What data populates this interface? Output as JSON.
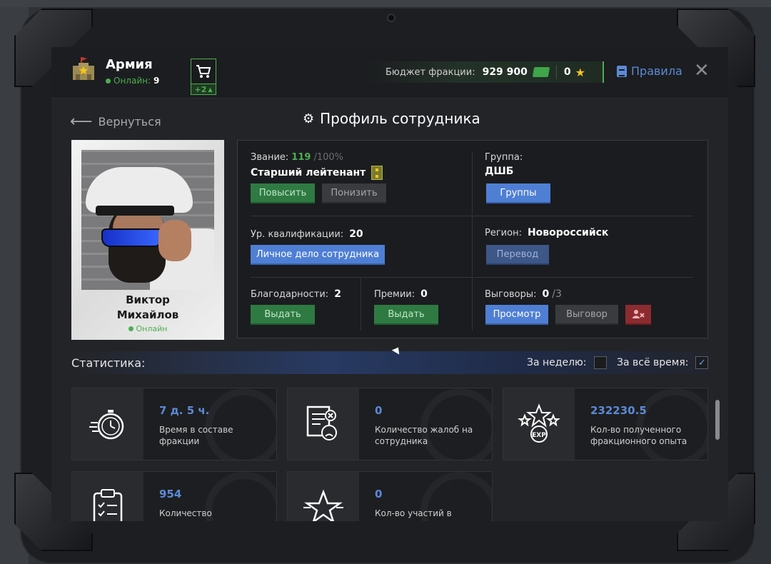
{
  "header": {
    "faction_name": "Армия",
    "online_label": "Онлайн:",
    "online_count": "9",
    "cart_badge": "+2",
    "budget_label": "Бюджет фракции:",
    "budget_value": "929 900",
    "stars_value": "0",
    "rules_label": "Правила"
  },
  "nav": {
    "back_label": "Вернуться",
    "page_title": "Профиль сотрудника"
  },
  "profile": {
    "name_line1": "Виктор",
    "name_line2": "Михайлов",
    "status": "Онлайн"
  },
  "info": {
    "rank_label": "Звание:",
    "rank_progress": "119",
    "rank_progress_max": "/100%",
    "rank_name": "Старший лейтенант",
    "promote_btn": "Повысить",
    "demote_btn": "Понизить",
    "group_label": "Группа:",
    "group_value": "ДШБ",
    "groups_btn": "Группы",
    "qual_label": "Ур. квалификации:",
    "qual_value": "20",
    "dossier_btn": "Личное дело сотрудника",
    "region_label": "Регион:",
    "region_value": "Новороссийск",
    "transfer_btn": "Перевод",
    "thanks_label": "Благодарности:",
    "thanks_value": "2",
    "thanks_btn": "Выдать",
    "bonus_label": "Премии:",
    "bonus_value": "0",
    "bonus_btn": "Выдать",
    "reprimand_label": "Выговоры:",
    "reprimand_value": "0",
    "reprimand_max": "/3",
    "view_btn": "Просмотр",
    "reprimand_btn": "Выговор"
  },
  "stats": {
    "title": "Статистика:",
    "week_label": "За неделю:",
    "alltime_label": "За всё время:",
    "week_checked": false,
    "alltime_checked": true,
    "cards": [
      {
        "value": "7 д. 5 ч.",
        "desc": "Время в составе фракции",
        "icon": "stopwatch-icon"
      },
      {
        "value": "0",
        "desc": "Количество жалоб на сотрудника",
        "icon": "complaint-icon"
      },
      {
        "value": "232230.5",
        "desc": "Кол-во полученного фракционного опыта",
        "icon": "exp-stars-icon"
      },
      {
        "value": "954",
        "desc": "Количество",
        "icon": "clipboard-icon"
      },
      {
        "value": "0",
        "desc": "Кол-во участий в",
        "icon": "star-icon"
      }
    ]
  },
  "colors": {
    "accent_blue": "#5b8ad6",
    "online_green": "#4caf50",
    "button_green": "#2f7a43",
    "button_red": "#8c2b2f"
  }
}
